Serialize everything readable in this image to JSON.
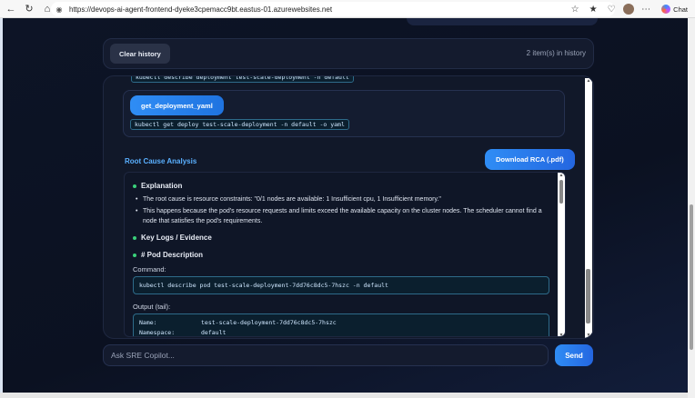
{
  "browser": {
    "url": "https://devops-ai-agent-frontend-dyeke3cpemacc9bt.eastus-01.azurewebsites.net",
    "chat_label": "Chat"
  },
  "toolbar": {
    "clear_label": "Clear history",
    "history_count": "2 item(s) in history"
  },
  "chat": {
    "partial_command": "kubectl describe deployment test-scale-deployment -n default",
    "tool_card": {
      "tool_name": "get_deployment_yaml",
      "command": "kubectl get deploy test-scale-deployment -n default -o yaml"
    },
    "rca": {
      "title": "Root Cause Analysis",
      "download_label": "Download RCA (.pdf)",
      "explanation_heading": "Explanation",
      "bullets": [
        "The root cause is resource constraints: \"0/1 nodes are available: 1 Insufficient cpu, 1 Insufficient memory.\"",
        "This happens because the pod's resource requests and limits exceed the available capacity on the cluster nodes. The scheduler cannot find a node that satisfies the pod's requirements."
      ],
      "key_logs_heading": "Key Logs / Evidence",
      "pod_desc_heading": "# Pod Description",
      "command_label": "Command:",
      "command": "kubectl describe pod test-scale-deployment-7dd76c8dc5-7hszc -n default",
      "output_label": "Output (tail):",
      "output_rows": [
        {
          "key": "Name:",
          "value": "test-scale-deployment-7dd76c8dc5-7hszc"
        },
        {
          "key": "Namespace:",
          "value": "default"
        }
      ]
    }
  },
  "input": {
    "placeholder": "Ask SRE Copilot...",
    "send_label": "Send"
  }
}
